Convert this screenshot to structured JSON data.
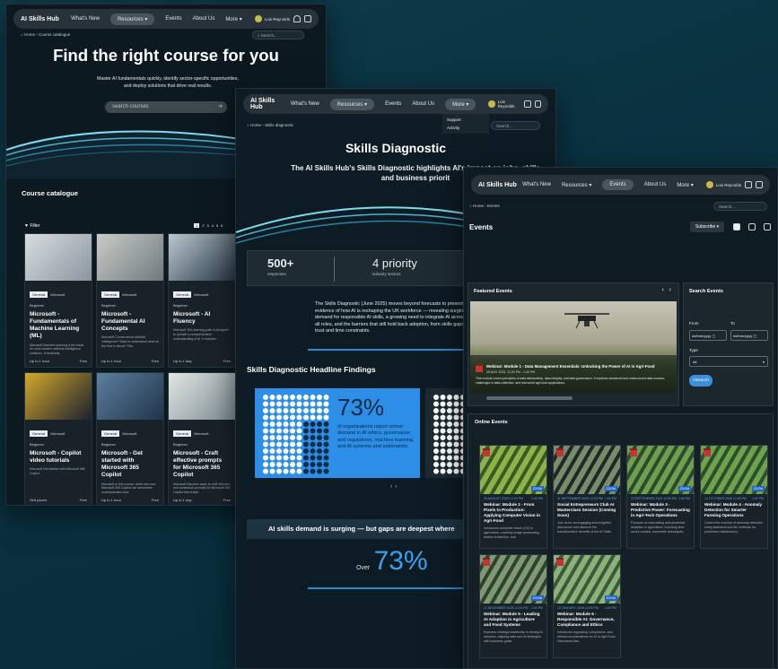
{
  "brand": "AI Skills Hub",
  "nav": {
    "whats_new": "What's New",
    "resources": "Resources",
    "events": "Events",
    "about": "About Us",
    "more": "More",
    "user": "Lois Reynolds"
  },
  "catalogue": {
    "crumb_home": "Home",
    "crumb_current": "Course catalogue",
    "search_placeholder": "Search...",
    "hero_title": "Find the right course for you",
    "hero_sub": "Master AI fundamentals quickly, identify sector-specific opportunities, and deploy solutions that drive real results.",
    "hero_search_placeholder": "search courses",
    "section_title": "Course catalogue",
    "filter_label": "Filter",
    "pages": [
      "1",
      "2",
      "3",
      "4",
      "5",
      "6"
    ],
    "courses": [
      {
        "tag1": "General",
        "tag2": "Microsoft",
        "level": "Beginner",
        "title": "Microsoft - Fundamentals of Machine Learning (ML)",
        "desc": "Microsoft Machine learning is the basis for most modern artificial intelligence solutions. A familiarity",
        "time": "Up to 1 hour",
        "price": "Free",
        "c1": "#d8dde0",
        "c2": "#8b95a0"
      },
      {
        "tag1": "General",
        "tag2": "Microsoft",
        "level": "Beginner",
        "title": "Microsoft - Fundamental AI Concepts",
        "desc": "Microsoft Course about artificial intelligence? Want to understand what all the fuss is about? This",
        "time": "Up to 1 hour",
        "price": "Free",
        "c1": "#c9ccc7",
        "c2": "#6f7a7e"
      },
      {
        "tag1": "General",
        "tag2": "Microsoft",
        "level": "Beginner",
        "title": "Microsoft - AI Fluency",
        "desc": "Microsoft This learning path is designed to provide a comprehensive understanding of AI. It includes",
        "time": "Up to 1 day",
        "price": "Free",
        "c1": "#b9c7cf",
        "c2": "#263744"
      },
      {
        "tag1": "General",
        "tag2": "Microsoft",
        "level": "Beginner",
        "title": "Microsoft - Copilot video tutorials",
        "desc": "Microsoft Get started with Microsoft 365 Copilot",
        "time": "Self paced",
        "price": "Free",
        "c1": "#d4a82a",
        "c2": "#1b2130"
      },
      {
        "tag1": "General",
        "tag2": "Microsoft",
        "level": "Beginner",
        "title": "Microsoft - Get started with Microsoft 365 Copilot",
        "desc": "Microsoft In this course, delve into how Microsoft 365 Copilot can streamline communication and",
        "time": "Up to 1 hour",
        "price": "Free",
        "c1": "#5d7f9f",
        "c2": "#20354a"
      },
      {
        "tag1": "General",
        "tag2": "Microsoft",
        "level": "Beginner",
        "title": "Microsoft - Craft effective prompts for Microsoft 365 Copilot",
        "desc": "Microsoft Discover ways to craft effective and contextual prompts for Microsoft 365 Copilot that create",
        "time": "Up to 1 day",
        "price": "Free",
        "c1": "#e3e6e3",
        "c2": "#7c8c93"
      }
    ]
  },
  "diagnostic": {
    "crumb_home": "Home",
    "crumb_current": "Skills diagnostic",
    "search_placeholder": "Search...",
    "more_menu": [
      "Support",
      "Activity"
    ],
    "title": "Skills Diagnostic",
    "lede": "The AI Skills Hub's Skills Diagnostic highlights AI's impact on jobs, skills and business priorit",
    "stats": [
      {
        "value": "500+",
        "label": "responses"
      },
      {
        "value": "4 priority",
        "label": "industry sectors"
      }
    ],
    "body": "The Skills Diagnostic (June 2025) moves beyond forecasts to present evidence of how AI is reshaping the UK workforce — revealing surging demand for responsible AI skills, a growing need to integrate AI across all roles, and the barriers that still hold back adoption, from skills gaps to trust and time constraints.",
    "findings_title": "Skills Diagnostic Headline Findings",
    "finding_pct": "73%",
    "finding_text": "of organisations report unmet demand in AI ethics, governance and regulations, machine learning, and AI systems and automation.",
    "banner": "AI skills demand is surging — but gaps are deepest where",
    "over_label": "Over",
    "over_pct": "73%"
  },
  "events": {
    "crumb_home": "Home",
    "crumb_current": "Events",
    "search_placeholder": "Search...",
    "title": "Events",
    "subscribe": "Subscribe",
    "featured_title": "Featured Events",
    "featured_event_title": "Webinar: Module 1 - Data Management Essentials: Unlocking the Power of AI in Agri-Food",
    "featured_event_date": "25 AUG 2025, 12:00 PM - 1:00 PM",
    "featured_event_desc": "This module covers principles of data stewardship, data integrity, and data governance. It explores structured and unstructured data sources, challenges in data collection, and real-world agri-food applications.",
    "search_title": "Search Events",
    "from_label": "From",
    "to_label": "To",
    "date_placeholder": "dd/mm/yyyy",
    "type_label": "Type",
    "type_value": "All",
    "search_button": "Search",
    "online_title": "Online Events",
    "cards": [
      {
        "date": "25 AUGUST 2025 12:00 PM",
        "time": "1:00 PM",
        "title": "Webinar: Module 2 - From Pixels to Production: Applying Computer Vision in Agri-Food",
        "desc": "Introduces computer vision (CV) in agriculture, covering image processing, feature extraction, and",
        "badge": "ZOOM",
        "c1": "#8bb34a",
        "c2": "#3a5a22"
      },
      {
        "date": "11 SEPTEMBER 2025 12:00 PM",
        "time": "1:00 PM",
        "title": "Social Entrepreneurs Club AI Masterclass Session (Coming Soon)",
        "desc": "Join us for an engaging and insightful discussion and discover the transformative benefits of the AI Skills",
        "badge": "ZOOM",
        "c1": "#7a8b6a",
        "c2": "#1e2a2a"
      },
      {
        "date": "22 SEPTEMBER 2025 12:00 PM",
        "time": "1:00 PM",
        "title": "Webinar: Module 3 - Predictive Power: Forecasting in Agri-Tech Operations",
        "desc": "Focuses on forecasting and predictive analytics in agriculture, including time series models, ensemble techniques,",
        "badge": "ZOOM",
        "c1": "#6e9f4c",
        "c2": "#2c4a30"
      },
      {
        "date": "13 OCTOBER 2025 12:00 PM",
        "time": "1:00 PM",
        "title": "Webinar: Module 4 - Anomaly Detection for Smarter Farming Operations",
        "desc": "Covers the concept of anomaly detection using statistical and ML methods for predictive maintenance,",
        "badge": "ZOOM",
        "c1": "#6ea24d",
        "c2": "#2b4f2c"
      },
      {
        "date": "12 DECEMBER 2025 12:00 PM",
        "time": "1:00 PM",
        "title": "Webinar: Module 5 - Leading AI Adoption in Agriculture and Food Systems",
        "desc": "Explores strategic leadership in driving AI adoption, aligning data and AI strategies with business goals,",
        "badge": "ZOOM",
        "c1": "#7d9b73",
        "c2": "#33402f"
      },
      {
        "date": "12 JANUARY 2026 12:00 PM",
        "time": "1:00 PM",
        "title": "Webinar: Module 6 - Responsible AI: Governance, Compliance and Ethics",
        "desc": "Introduces regulatory, compliance, and ethical considerations for AI in Agri-Food. Discusses bias,",
        "badge": "ZOOM",
        "c1": "#8cb27a",
        "c2": "#3c5a3a"
      }
    ]
  }
}
